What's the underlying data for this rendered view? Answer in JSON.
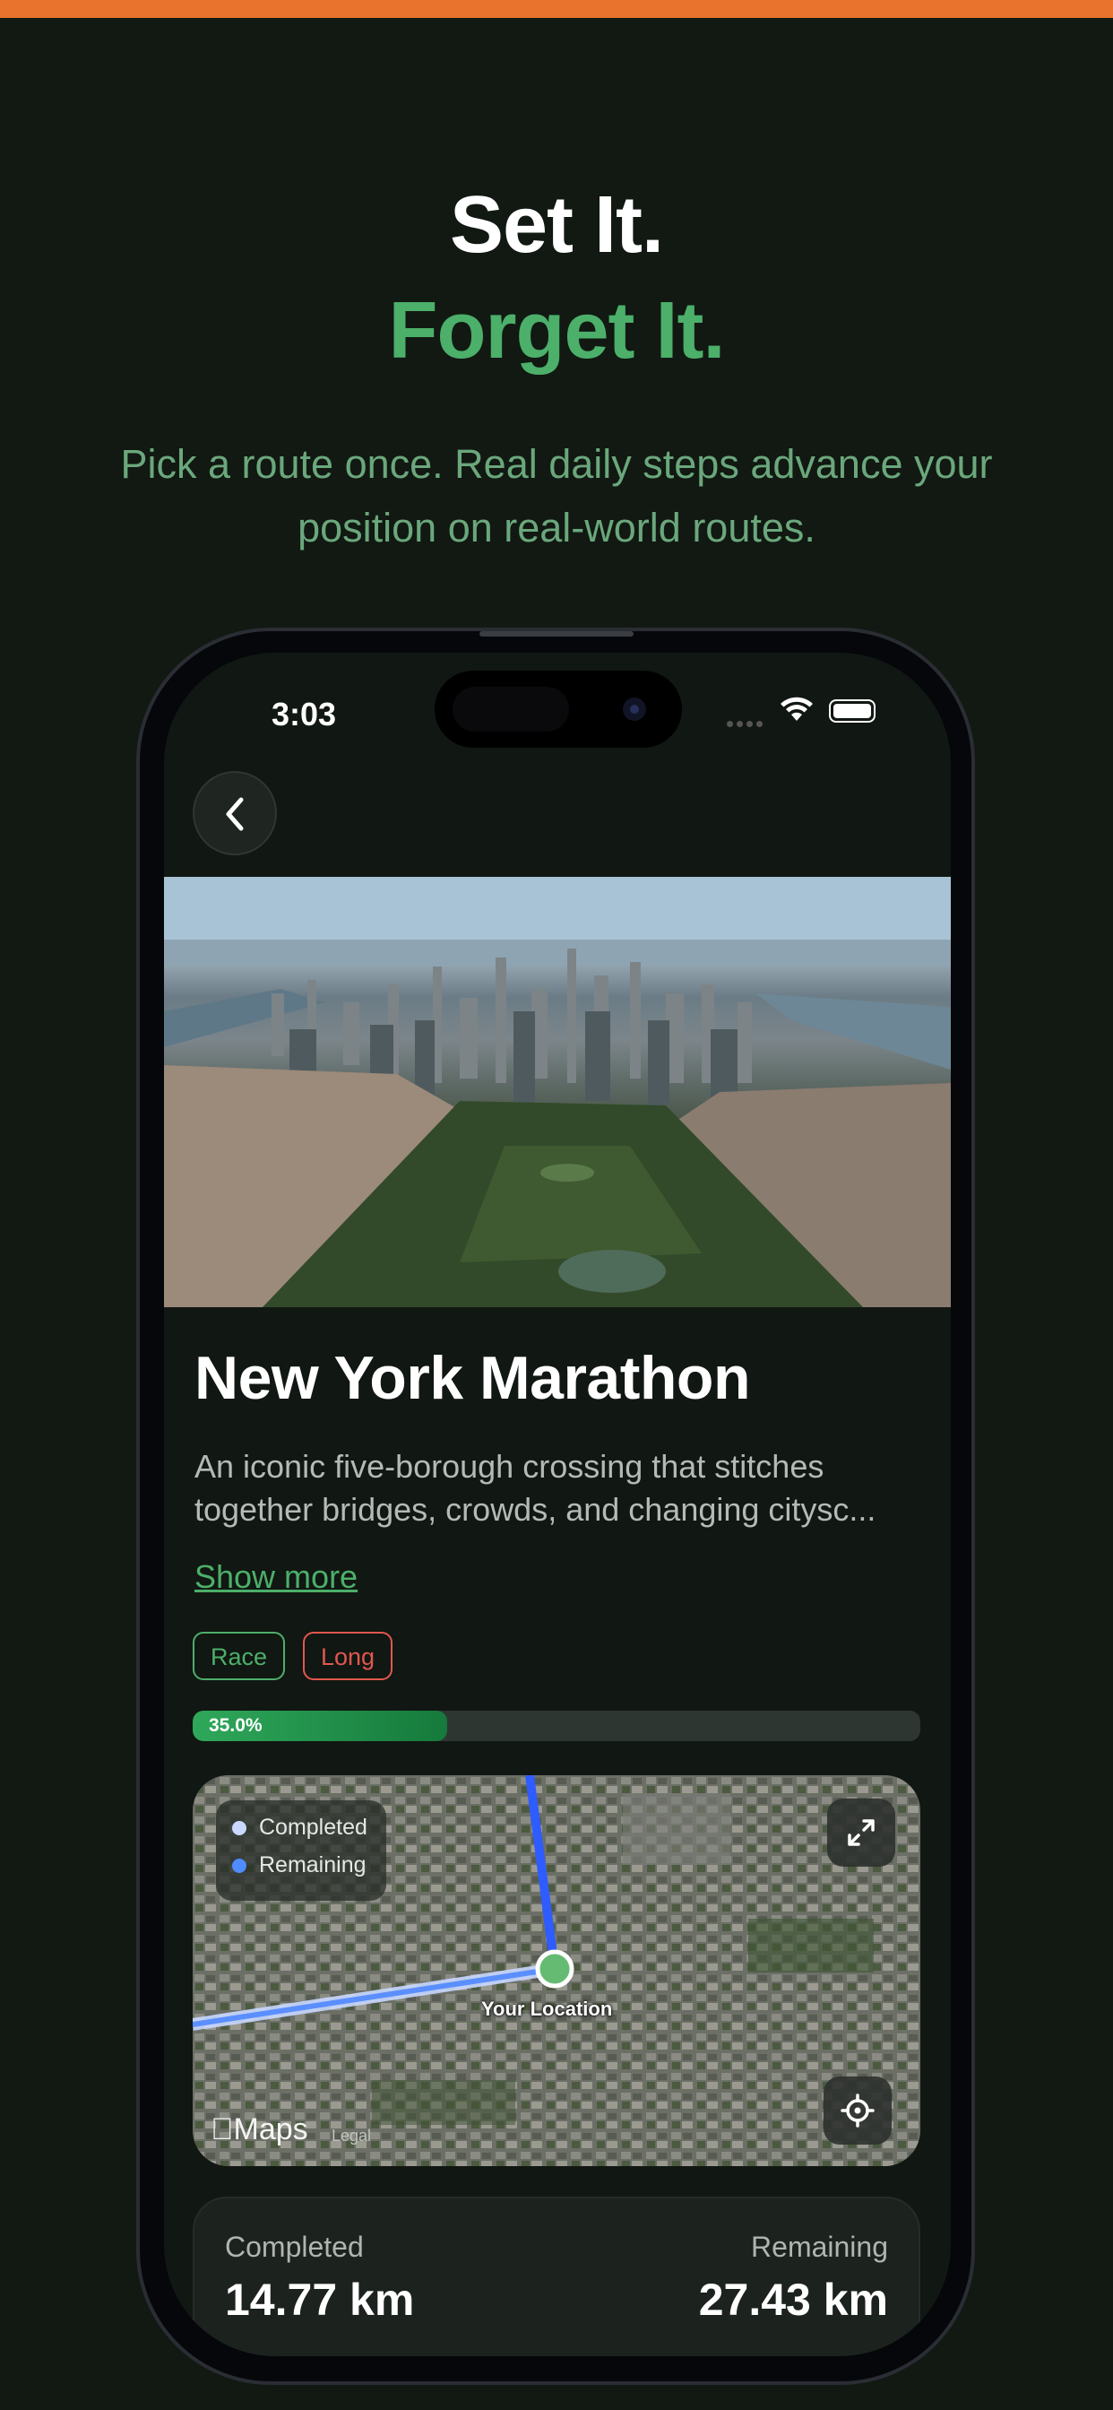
{
  "hero": {
    "line1": "Set It.",
    "line2": "Forget It.",
    "subtitle": "Pick a route once. Real daily steps advance your position on real-world routes."
  },
  "status_bar": {
    "time": "3:03"
  },
  "route": {
    "title": "New York Marathon",
    "description": "An iconic five-borough crossing that stitches together bridges, crowds, and changing citysc...",
    "show_more": "Show more",
    "tags": [
      "Race",
      "Long"
    ],
    "progress_percent": 35.0,
    "progress_label": "35.0%"
  },
  "map": {
    "legend": {
      "completed": "Completed",
      "remaining": "Remaining"
    },
    "location_label": "Your Location",
    "attribution": "Maps",
    "legal": "Legal"
  },
  "stats": {
    "completed_label": "Completed",
    "completed_value": "14.77 km",
    "remaining_label": "Remaining",
    "remaining_value": "27.43 km"
  },
  "colors": {
    "accent_orange": "#E9722C",
    "brand_green": "#4CAF6A",
    "tag_long": "#e0584f",
    "legend_completed": "#c9d8ff",
    "legend_remaining": "#4e8cff"
  }
}
